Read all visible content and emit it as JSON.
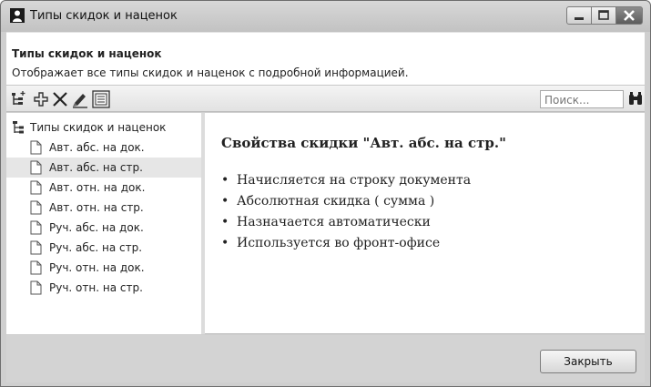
{
  "window": {
    "title": "Типы скидок и наценок",
    "controls": {
      "minimize_icon": "minimize-icon",
      "maximize_icon": "maximize-icon",
      "close_icon": "close-icon"
    }
  },
  "header": {
    "title": "Типы скидок и наценок",
    "description": "Отображает все типы скидок и наценок с подробной информацией."
  },
  "toolbar": {
    "buttons": [
      "add-folder-icon",
      "add-icon",
      "delete-icon",
      "edit-icon",
      "properties-icon"
    ],
    "search": {
      "placeholder": "Поиск...",
      "value": ""
    },
    "search_icon": "binoculars-icon"
  },
  "tree": {
    "root": "Типы скидок и наценок",
    "items": [
      "Авт. абс. на док.",
      "Авт. абс. на стр.",
      "Авт. отн. на док.",
      "Авт. отн. на стр.",
      "Руч. абс. на док.",
      "Руч. абс. на стр.",
      "Руч. отн. на док.",
      "Руч. отн. на стр."
    ],
    "selected_index": 1
  },
  "details": {
    "heading": "Свойства скидки \"Авт. абс. на стр.\"",
    "properties": [
      "Начисляется на строку документа",
      "Абсолютная скидка ( сумма )",
      "Назначается автоматически",
      "Используется во фронт-офисе"
    ]
  },
  "footer": {
    "close_label": "Закрыть"
  }
}
